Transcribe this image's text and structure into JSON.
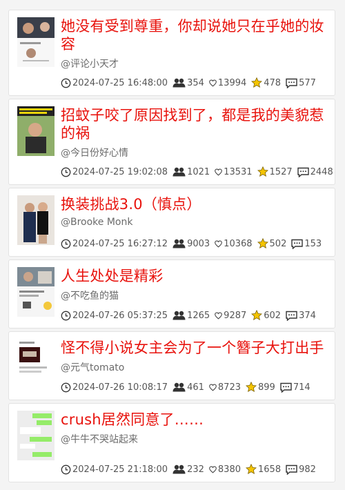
{
  "videos": [
    {
      "title": "她没有受到尊重，你却说她只在乎她的妆容",
      "author": "@评论小天才",
      "time": "2024-07-25 16:48:00",
      "views": "354",
      "likes": "13994",
      "favorites": "478",
      "comments": "577"
    },
    {
      "title": "招蚊子咬了原因找到了，都是我的美貌惹的祸",
      "author": "@今日份好心情",
      "time": "2024-07-25 19:02:08",
      "views": "1021",
      "likes": "13531",
      "favorites": "1527",
      "comments": "2448"
    },
    {
      "title": "换装挑战3.0（慎点）",
      "author": "@Brooke Monk",
      "time": "2024-07-25 16:27:12",
      "views": "9003",
      "likes": "10368",
      "favorites": "502",
      "comments": "153"
    },
    {
      "title": "人生处处是精彩",
      "author": "@不吃鱼的猫",
      "time": "2024-07-26 05:37:25",
      "views": "1265",
      "likes": "9287",
      "favorites": "602",
      "comments": "374"
    },
    {
      "title": "怪不得小说女主会为了一个簪子大打出手",
      "author": "@元气tomato",
      "time": "2024-07-26 10:08:17",
      "views": "461",
      "likes": "8723",
      "favorites": "899",
      "comments": "714"
    },
    {
      "title": "crush居然同意了……",
      "author": "@牛牛不哭站起来",
      "time": "2024-07-25 21:18:00",
      "views": "232",
      "likes": "8380",
      "favorites": "1658",
      "comments": "982"
    }
  ],
  "icons": {
    "time": "clock-icon",
    "views": "people-icon",
    "likes": "heart-icon",
    "favorites": "star-icon",
    "comments": "comment-icon"
  },
  "colors": {
    "title": "#e8120c",
    "star": "#f4c400"
  }
}
